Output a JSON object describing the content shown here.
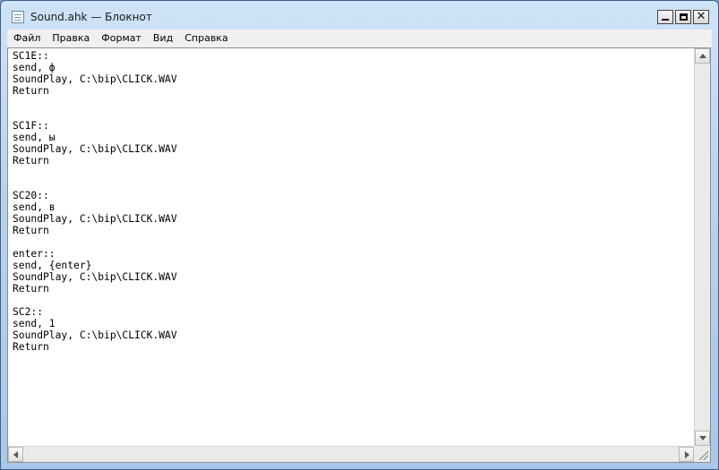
{
  "window": {
    "title": "Sound.ahk — Блокнот"
  },
  "menu": [
    {
      "label": "Файл"
    },
    {
      "label": "Правка"
    },
    {
      "label": "Формат"
    },
    {
      "label": "Вид"
    },
    {
      "label": "Справка"
    }
  ],
  "editor": {
    "text": "SC1E::\nsend, ф\nSoundPlay, C:\\bip\\CLICK.WAV\nReturn\n\n\nSC1F::\nsend, ы\nSoundPlay, C:\\bip\\CLICK.WAV\nReturn\n\n\nSC20::\nsend, в\nSoundPlay, C:\\bip\\CLICK.WAV\nReturn\n\nenter::\nsend, {enter}\nSoundPlay, C:\\bip\\CLICK.WAV\nReturn\n\nSC2::\nsend, 1\nSoundPlay, C:\\bip\\CLICK.WAV\nReturn"
  },
  "icons": {
    "app": "notepad-icon",
    "minimize": "minimize-icon",
    "maximize": "maximize-icon",
    "close": "close-icon",
    "close_glyph": "✕"
  }
}
